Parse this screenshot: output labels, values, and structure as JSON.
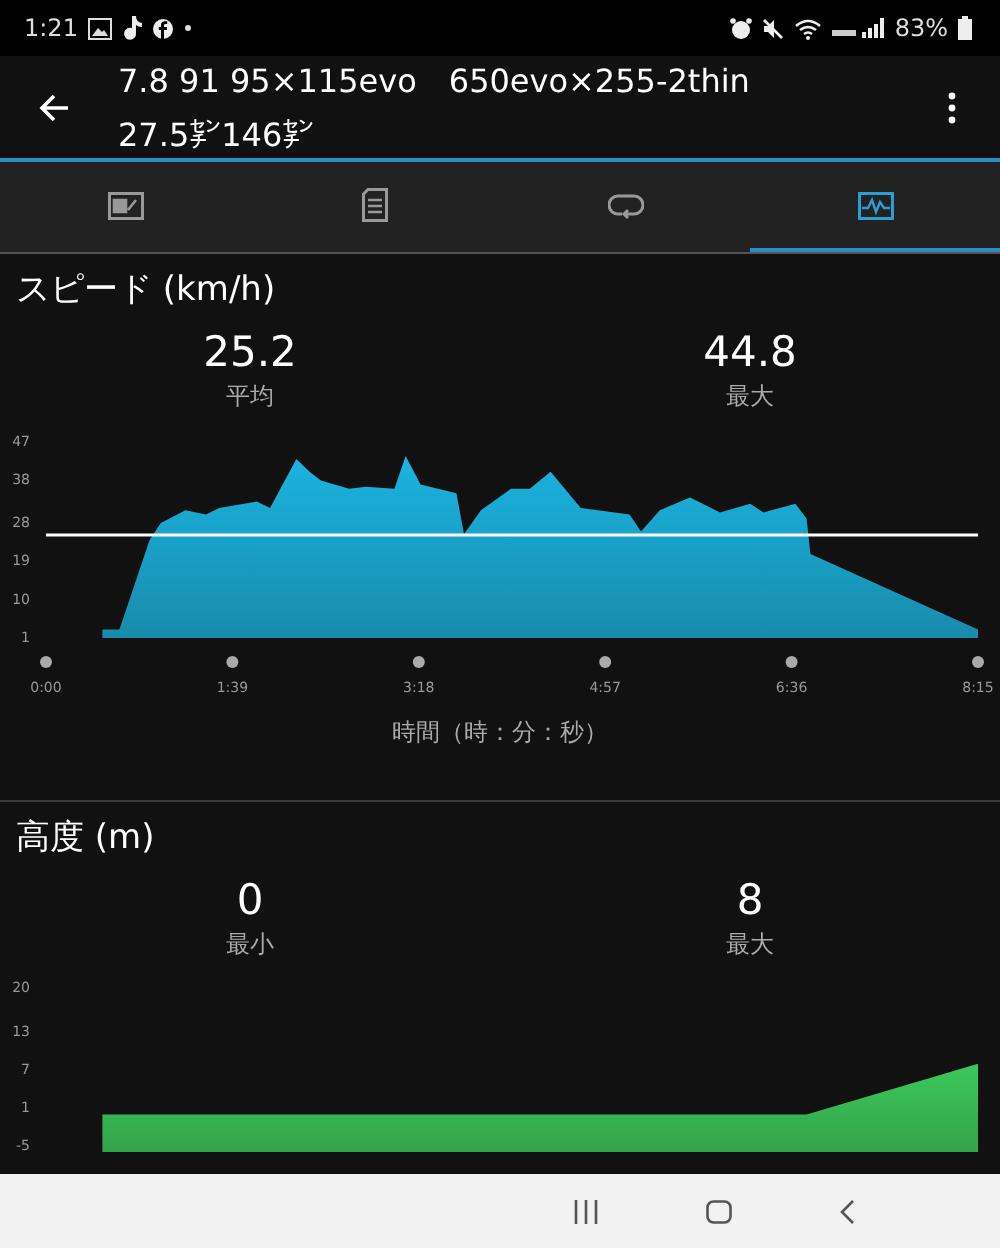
{
  "status_bar": {
    "time": "1:21",
    "battery": "83%"
  },
  "app_bar": {
    "title_line_1": "7.8 91 95×115evo　650evo×255-2thin",
    "title_line_2": "27.5㌢146㌢"
  },
  "tabs": [
    {
      "kind": "summary",
      "selected": false
    },
    {
      "kind": "details",
      "selected": false
    },
    {
      "kind": "laps",
      "selected": false
    },
    {
      "kind": "charts",
      "selected": true
    }
  ],
  "sections": [
    {
      "title": "スピード (km/h)",
      "stats": [
        {
          "value": "25.2",
          "label": "平均"
        },
        {
          "value": "44.8",
          "label": "最大"
        }
      ],
      "axis_title": "時間（時：分：秒）",
      "chart_data": {
        "type": "area",
        "xlim": [
          0,
          495
        ],
        "ylim": [
          1,
          47
        ],
        "xticks": [
          {
            "value": 0,
            "label": "0:00"
          },
          {
            "value": 99,
            "label": "1:39"
          },
          {
            "value": 198,
            "label": "3:18"
          },
          {
            "value": 297,
            "label": "4:57"
          },
          {
            "value": 396,
            "label": "6:36"
          },
          {
            "value": 495,
            "label": "8:15"
          }
        ],
        "yticks": [
          1,
          10,
          19,
          28,
          38,
          47
        ],
        "x": [
          30,
          39,
          55,
          61,
          74,
          85,
          92,
          112,
          119,
          133,
          140,
          146,
          161,
          170,
          185,
          191,
          199,
          218,
          222,
          231,
          247,
          257,
          268,
          284,
          310,
          316,
          326,
          342,
          358,
          374,
          381,
          398,
          404,
          406,
          495
        ],
        "series": [
          {
            "color": "#1ab4e0",
            "values": [
              3,
              3,
              24,
              28,
              31,
              30,
              31.5,
              33,
              31.5,
              43,
              40,
              38,
              36,
              36.5,
              36,
              43.7,
              37,
              35,
              25.4,
              31,
              36,
              36,
              40,
              31.5,
              30,
              26,
              31,
              34,
              30.5,
              32.5,
              30.5,
              32.5,
              29,
              20.7,
              3
            ]
          }
        ],
        "ref_lines": [
          {
            "axis": "y",
            "value": 25.2
          }
        ]
      }
    },
    {
      "title": "高度 (m)",
      "stats": [
        {
          "value": "0",
          "label": "最小"
        },
        {
          "value": "8",
          "label": "最大"
        }
      ],
      "chart_data": {
        "type": "area",
        "xlim": [
          0,
          495
        ],
        "ylim": [
          -5,
          20
        ],
        "yticks": [
          -5,
          1,
          7,
          13,
          20
        ],
        "x": [
          30,
          404,
          495
        ],
        "series": [
          {
            "color": "#3cc85a",
            "values": [
              0,
              0,
              8
            ]
          }
        ]
      }
    }
  ]
}
